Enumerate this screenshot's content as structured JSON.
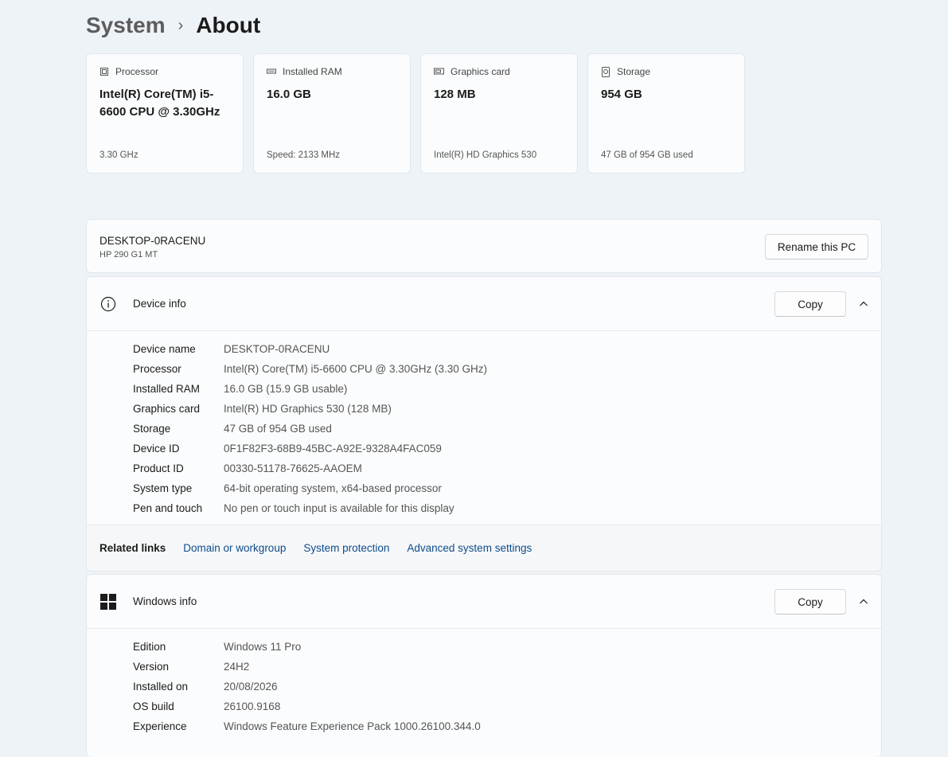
{
  "breadcrumb": {
    "parent": "System",
    "separator": "›",
    "current": "About"
  },
  "spec_cards": [
    {
      "icon": "processor-icon",
      "label": "Processor",
      "value": "Intel(R) Core(TM) i5-6600 CPU @ 3.30GHz",
      "sub": "3.30 GHz"
    },
    {
      "icon": "ram-icon",
      "label": "Installed RAM",
      "value": "16.0 GB",
      "sub": "Speed: 2133 MHz"
    },
    {
      "icon": "graphics-card-icon",
      "label": "Graphics card",
      "value": "128 MB",
      "sub": "Intel(R) HD Graphics 530"
    },
    {
      "icon": "storage-icon",
      "label": "Storage",
      "value": "954 GB",
      "sub": "47 GB of 954 GB used"
    }
  ],
  "pc": {
    "name": "DESKTOP-0RACENU",
    "model": "HP 290 G1 MT",
    "rename_label": "Rename this PC"
  },
  "device_info": {
    "title": "Device info",
    "copy_label": "Copy",
    "rows": [
      {
        "key": "Device name",
        "value": "DESKTOP-0RACENU"
      },
      {
        "key": "Processor",
        "value": "Intel(R) Core(TM) i5-6600 CPU @ 3.30GHz (3.30 GHz)"
      },
      {
        "key": "Installed RAM",
        "value": "16.0 GB (15.9 GB usable)"
      },
      {
        "key": "Graphics card",
        "value": "Intel(R) HD Graphics 530 (128 MB)"
      },
      {
        "key": "Storage",
        "value": "47 GB of 954 GB used"
      },
      {
        "key": "Device ID",
        "value": "0F1F82F3-68B9-45BC-A92E-9328A4FAC059"
      },
      {
        "key": "Product ID",
        "value": "00330-51178-76625-AAOEM"
      },
      {
        "key": "System type",
        "value": "64-bit operating system, x64-based processor"
      },
      {
        "key": "Pen and touch",
        "value": "No pen or touch input is available for this display"
      }
    ],
    "related_label": "Related links",
    "related_links": [
      "Domain or workgroup",
      "System protection",
      "Advanced system settings"
    ]
  },
  "windows_info": {
    "title": "Windows info",
    "copy_label": "Copy",
    "rows": [
      {
        "key": "Edition",
        "value": "Windows 11 Pro"
      },
      {
        "key": "Version",
        "value": "24H2"
      },
      {
        "key": "Installed on",
        "value": "20/08/2026"
      },
      {
        "key": "OS build",
        "value": "26100.9168"
      },
      {
        "key": "Experience",
        "value": "Windows Feature Experience Pack 1000.26100.344.0"
      }
    ]
  },
  "colors": {
    "background": "#eef3f8",
    "card": "#fbfcfd",
    "link": "#0f4c8a"
  }
}
